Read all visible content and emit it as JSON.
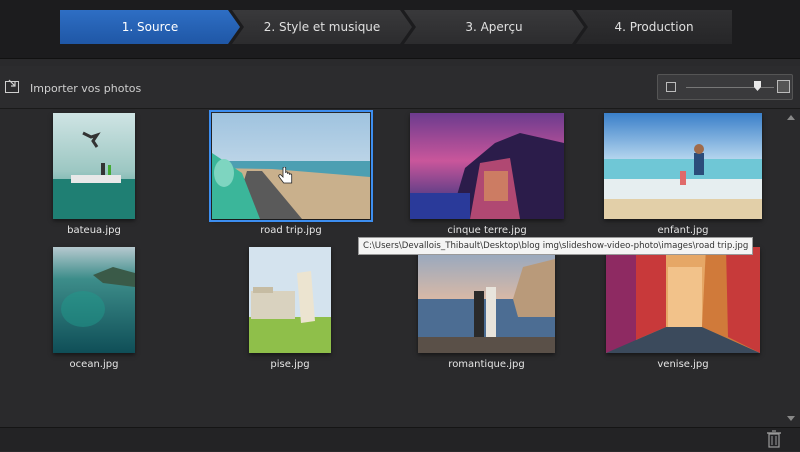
{
  "wizard": {
    "steps": [
      {
        "label": "1. Source",
        "active": true
      },
      {
        "label": "2. Style et musique",
        "active": false
      },
      {
        "label": "3. Aperçu",
        "active": false
      },
      {
        "label": "4. Production",
        "active": false
      }
    ]
  },
  "toolbar": {
    "import_label": "Importer vos photos",
    "import_icon": "import-photo-icon",
    "zoom": {
      "small_icon": "thumbnail-small-icon",
      "large_icon": "thumbnail-large-icon",
      "level": 0.85
    }
  },
  "photos": [
    {
      "name": "bateua.jpg",
      "selected": false
    },
    {
      "name": "road trip.jpg",
      "selected": true
    },
    {
      "name": "cinque terre.jpg",
      "selected": false
    },
    {
      "name": "enfant.jpg",
      "selected": false
    },
    {
      "name": "ocean.jpg",
      "selected": false
    },
    {
      "name": "pise.jpg",
      "selected": false
    },
    {
      "name": "romantique.jpg",
      "selected": false
    },
    {
      "name": "venise.jpg",
      "selected": false
    }
  ],
  "tooltip": {
    "text": "C:\\Users\\Devallois_Thibault\\Desktop\\blog img\\slideshow-video-photo\\images\\road trip.jpg"
  },
  "bottombar": {
    "delete_icon": "trash-icon"
  },
  "colors": {
    "accent": "#2e6ec4",
    "selection": "#3d8ef0",
    "background": "#2a2a2c"
  }
}
